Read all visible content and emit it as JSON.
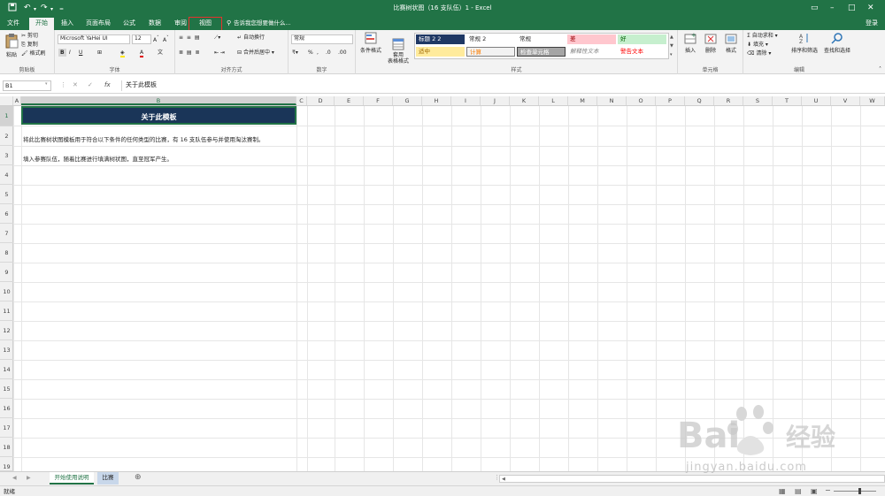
{
  "window": {
    "title": "比赛树状图（16 支队伍）1 - Excel",
    "login": "登录"
  },
  "tabs": [
    {
      "label": "文件"
    },
    {
      "label": "开始"
    },
    {
      "label": "插入"
    },
    {
      "label": "页面布局"
    },
    {
      "label": "公式"
    },
    {
      "label": "数据"
    },
    {
      "label": "审阅"
    },
    {
      "label": "视图"
    }
  ],
  "tellme": "告诉我您想要做什么...",
  "ribbon": {
    "clipboard": {
      "paste": "粘贴",
      "cut": "剪切",
      "copy": "复制",
      "format_painter": "格式刷",
      "label": "剪贴板"
    },
    "font": {
      "name": "Microsoft YaHei UI",
      "size": "12",
      "label": "字体"
    },
    "align": {
      "wrap": "自动换行",
      "merge": "合并后居中",
      "label": "对齐方式"
    },
    "number": {
      "format": "常规",
      "label": "数字"
    },
    "styles": {
      "conditional": "条件格式",
      "table": "套用\n表格格式",
      "cells": [
        {
          "label": "标题 2 2",
          "bg": "#1f3864",
          "fg": "#ffffff"
        },
        {
          "label": "常规 2",
          "bg": "#ffffff",
          "fg": "#262626"
        },
        {
          "label": "常规",
          "bg": "#ffffff",
          "fg": "#262626"
        },
        {
          "label": "差",
          "bg": "#ffc7ce",
          "fg": "#9c0006"
        },
        {
          "label": "好",
          "bg": "#c6efce",
          "fg": "#006100"
        },
        {
          "label": "适中",
          "bg": "#ffeb9c",
          "fg": "#9c6500"
        },
        {
          "label": "计算",
          "bg": "#f2f2f2",
          "fg": "#fa7d00"
        },
        {
          "label": "检查单元格",
          "bg": "#a5a5a5",
          "fg": "#ffffff"
        },
        {
          "label": "解释性文本",
          "bg": "#ffffff",
          "fg": "#7f7f7f"
        },
        {
          "label": "警告文本",
          "bg": "#ffffff",
          "fg": "#ff0000"
        }
      ],
      "label": "样式"
    },
    "cells": {
      "insert": "插入",
      "delete": "删除",
      "format": "格式",
      "label": "单元格"
    },
    "editing": {
      "autosum": "自动求和",
      "fill": "填充",
      "clear": "清除",
      "sort": "排序和筛选",
      "find": "查找和选择",
      "label": "编辑"
    }
  },
  "formula_bar": {
    "name_box": "B1",
    "content": "关于此模板"
  },
  "columns": [
    "A",
    "B",
    "C",
    "D",
    "E",
    "F",
    "G",
    "H",
    "I",
    "J",
    "K",
    "L",
    "M",
    "N",
    "O",
    "P",
    "Q",
    "R",
    "S",
    "T",
    "U",
    "V",
    "W"
  ],
  "rows": [
    "1",
    "2",
    "3",
    "4",
    "5",
    "6",
    "7",
    "8",
    "9",
    "10",
    "11",
    "12",
    "13",
    "14",
    "15",
    "16",
    "17",
    "18",
    "19"
  ],
  "cells": {
    "b1": "关于此模板",
    "b2": "将此比赛树状图模板用于符合以下条件的任何类型的比赛，有 16 支队伍参与并使用淘汰赛制。",
    "b3": "填入参赛队伍，随着比赛进行填满树状图，直至冠军产生。"
  },
  "sheets": [
    {
      "label": "开始使用说明"
    },
    {
      "label": "比赛"
    }
  ],
  "status": {
    "ready": "就绪"
  },
  "watermark": {
    "brand": "Bai",
    "brand2": "经验",
    "url": "jingyan.baidu.com"
  },
  "colors": {
    "excel_green": "#217346",
    "header_dark": "#1a3558",
    "highlight": "#e6322d"
  }
}
